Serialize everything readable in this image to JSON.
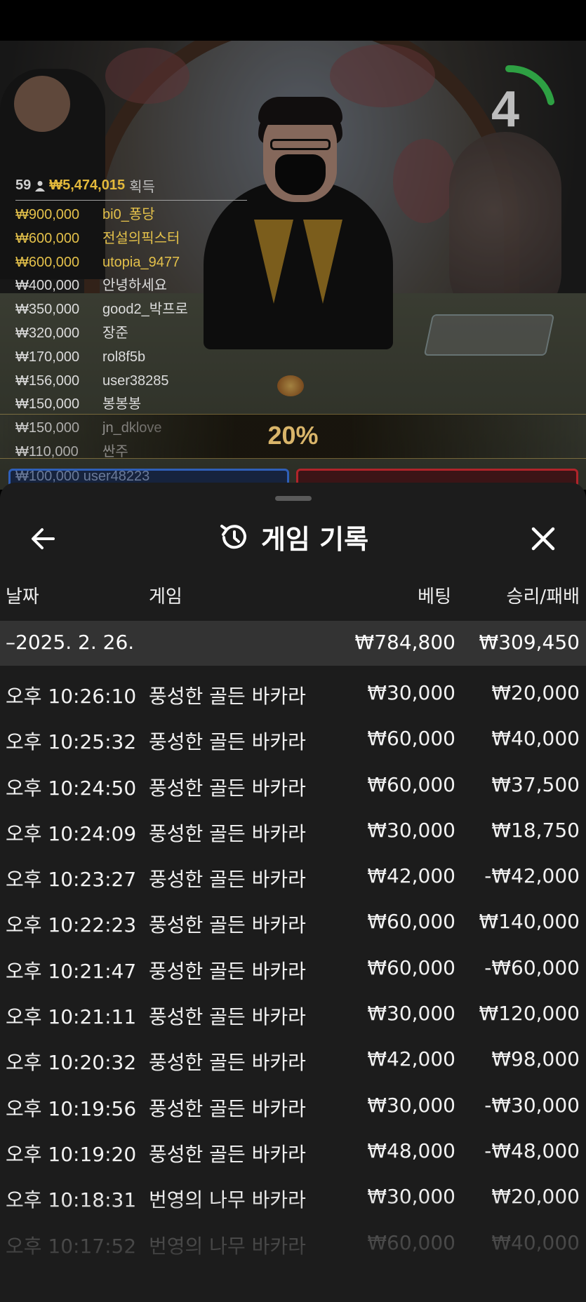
{
  "video": {
    "timer": "4",
    "stats_count": "59",
    "stats_total": "₩5,474,015",
    "stats_word": "획득",
    "winners": [
      {
        "amount": "₩900,000",
        "name": "bi0_퐁당",
        "gold": true
      },
      {
        "amount": "₩600,000",
        "name": "전설의픽스터",
        "gold": true
      },
      {
        "amount": "₩600,000",
        "name": "utopia_9477",
        "gold": true
      },
      {
        "amount": "₩400,000",
        "name": "안녕하세요",
        "gold": false
      },
      {
        "amount": "₩350,000",
        "name": "good2_박프로",
        "gold": false
      },
      {
        "amount": "₩320,000",
        "name": "장준",
        "gold": false
      },
      {
        "amount": "₩170,000",
        "name": "rol8f5b",
        "gold": false
      },
      {
        "amount": "₩156,000",
        "name": "user38285",
        "gold": false
      },
      {
        "amount": "₩150,000",
        "name": "봉봉봉",
        "gold": false
      },
      {
        "amount": "₩150,000",
        "name": "jn_dklove",
        "gold": false
      },
      {
        "amount": "₩110,000",
        "name": "싼주",
        "gold": false
      }
    ],
    "ghost_winner": "₩100,000 user48223",
    "percent": "20%"
  },
  "panel": {
    "title": "게임 기록",
    "columns": {
      "date": "날짜",
      "game": "게임",
      "bet": "베팅",
      "result": "승리/패배"
    },
    "summary": {
      "date": "–2025. 2. 26.",
      "bet": "₩784,800",
      "result": "₩309,450"
    },
    "rows": [
      {
        "time": "오후 10:26:10",
        "game": "풍성한 골든 바카라",
        "bet": "₩30,000",
        "result": "₩20,000"
      },
      {
        "time": "오후 10:25:32",
        "game": "풍성한 골든 바카라",
        "bet": "₩60,000",
        "result": "₩40,000"
      },
      {
        "time": "오후 10:24:50",
        "game": "풍성한 골든 바카라",
        "bet": "₩60,000",
        "result": "₩37,500"
      },
      {
        "time": "오후 10:24:09",
        "game": "풍성한 골든 바카라",
        "bet": "₩30,000",
        "result": "₩18,750"
      },
      {
        "time": "오후 10:23:27",
        "game": "풍성한 골든 바카라",
        "bet": "₩42,000",
        "result": "-₩42,000"
      },
      {
        "time": "오후 10:22:23",
        "game": "풍성한 골든 바카라",
        "bet": "₩60,000",
        "result": "₩140,000"
      },
      {
        "time": "오후 10:21:47",
        "game": "풍성한 골든 바카라",
        "bet": "₩60,000",
        "result": "-₩60,000"
      },
      {
        "time": "오후 10:21:11",
        "game": "풍성한 골든 바카라",
        "bet": "₩30,000",
        "result": "₩120,000"
      },
      {
        "time": "오후 10:20:32",
        "game": "풍성한 골든 바카라",
        "bet": "₩42,000",
        "result": "₩98,000"
      },
      {
        "time": "오후 10:19:56",
        "game": "풍성한 골든 바카라",
        "bet": "₩30,000",
        "result": "-₩30,000"
      },
      {
        "time": "오후 10:19:20",
        "game": "풍성한 골든 바카라",
        "bet": "₩48,000",
        "result": "-₩48,000"
      },
      {
        "time": "오후 10:18:31",
        "game": "번영의 나무 바카라",
        "bet": "₩30,000",
        "result": "₩20,000"
      },
      {
        "time": "오후 10:17:52",
        "game": "번영의 나무 바카라",
        "bet": "₩60,000",
        "result": "₩40,000"
      }
    ]
  },
  "colors": {
    "gold": "#e3c04a",
    "panel_bg": "#1c1c1c",
    "summary_bg": "#333333",
    "timer_green": "#2ea043"
  },
  "icons": [
    "back-arrow-icon",
    "history-icon",
    "close-icon",
    "person-icon"
  ]
}
